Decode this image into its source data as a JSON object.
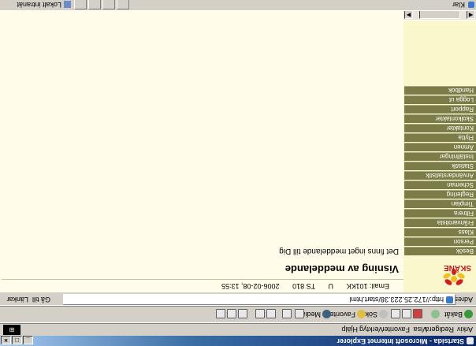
{
  "window": {
    "title": "Startsida - Microsoft Internet Explorer",
    "minimize": "_",
    "maximize": "□",
    "close": "×"
  },
  "menubar": {
    "items": [
      "Arkiv",
      "Redigera",
      "Visa",
      "Favoriter",
      "Verktyg",
      "Hjälp"
    ]
  },
  "toolbar": {
    "back": "Bakåt",
    "search": "Sök",
    "favorites": "Favoriter",
    "media": "Media"
  },
  "address": {
    "label": "Adress",
    "url": "http://172.25.223.38/start.html",
    "go": "Gå till",
    "links": "Länkar"
  },
  "sidebar": {
    "logo_text": "SKÅNE",
    "items": [
      "Besök",
      "Person",
      "Klass",
      "Frånvarolista",
      "Filtrera",
      "Timplan",
      "Reglering",
      "Scheman",
      "Användarstatistik",
      "Statistik",
      "Inställningar",
      "Ämnen",
      "Flytta",
      "Kontakter",
      "Skolkontakter",
      "Rapport",
      "Logga ut",
      "Handbok"
    ]
  },
  "main": {
    "user": "Email: 101KK",
    "role": "U",
    "school": "TS 810",
    "datetime": "2006-02-08, 13:55",
    "heading": "Visning av meddelande",
    "message": "Det finns inget meddelande till Dig"
  },
  "statusbar": {
    "text": "Klar",
    "zone": "Lokalt intranät"
  },
  "colors": {
    "menu_bg": "#7c7c48",
    "sidebar_bg": "#fbf7cc",
    "content_bg": "#fffcea"
  }
}
